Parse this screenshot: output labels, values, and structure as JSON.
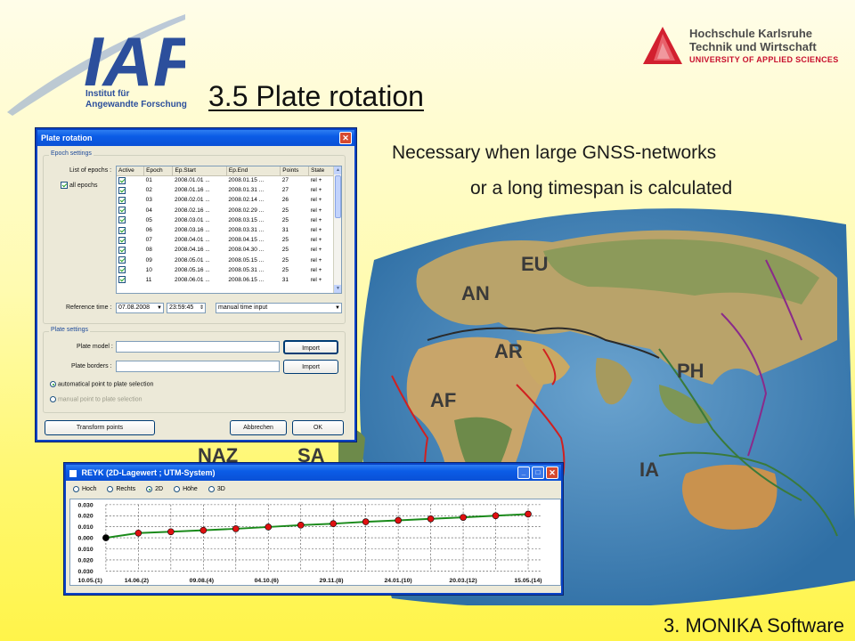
{
  "slide": {
    "title": "3.5 Plate rotation",
    "bullet_line_1": "Necessary when large GNSS-networks",
    "bullet_line_2": "or a long timespan is calculated",
    "footer": "3. MONIKA Software"
  },
  "logos": {
    "iaf_text": "IAF",
    "iaf_caption_1": "Institut für",
    "iaf_caption_2": "Angewandte Forschung",
    "hs_line_1": "Hochschule Karlsruhe",
    "hs_line_2": "Technik und Wirtschaft",
    "hs_line_3": "UNIVERSITY OF APPLIED SCIENCES"
  },
  "map": {
    "plate_labels": [
      "EU",
      "AN",
      "AR",
      "AF",
      "PH",
      "IA",
      "NAZ",
      "SA"
    ]
  },
  "plate_dialog": {
    "title": "Plate rotation",
    "epoch_group": "Epoch settings",
    "list_label": "List of epochs :",
    "all_epochs": "all epochs",
    "columns": [
      "Active",
      "Epoch",
      "Ep.Start",
      "Ep.End",
      "Points",
      "State"
    ],
    "rows": [
      [
        "01",
        "2008.01.01 ...",
        "2008.01.15 ...",
        "27",
        "rel +"
      ],
      [
        "02",
        "2008.01.16 ...",
        "2008.01.31 ...",
        "27",
        "rel +"
      ],
      [
        "03",
        "2008.02.01 ...",
        "2008.02.14 ...",
        "26",
        "rel +"
      ],
      [
        "04",
        "2008.02.16 ...",
        "2008.02.29 ...",
        "25",
        "rel +"
      ],
      [
        "05",
        "2008.03.01 ...",
        "2008.03.15 ...",
        "25",
        "rel +"
      ],
      [
        "06",
        "2008.03.16 ...",
        "2008.03.31 ...",
        "31",
        "rel +"
      ],
      [
        "07",
        "2008.04.01 ...",
        "2008.04.15 ...",
        "25",
        "rel +"
      ],
      [
        "08",
        "2008.04.16 ...",
        "2008.04.30 ...",
        "25",
        "rel +"
      ],
      [
        "09",
        "2008.05.01 ...",
        "2008.05.15 ...",
        "25",
        "rel +"
      ],
      [
        "10",
        "2008.05.16 ...",
        "2008.05.31 ...",
        "25",
        "rel +"
      ],
      [
        "11",
        "2008.06.01 ...",
        "2008.06.15 ...",
        "31",
        "rel +"
      ]
    ],
    "reference_label": "Reference time :",
    "reference_date": "07.08.2008",
    "reference_time": "23:59:45",
    "time_mode": "manual time input",
    "plate_group": "Plate settings",
    "plate_model_label": "Plate model :",
    "plate_borders_label": "Plate borders :",
    "import_label": "Import",
    "auto_point": "automatical point to plate selection",
    "manual_point": "manual point to plate selection",
    "transform_label": "Transform points",
    "cancel_label": "Abbrechen",
    "ok_label": "OK"
  },
  "reyk_window": {
    "title": "REYK (2D-Lagewert ; UTM-System)",
    "radio_options": [
      "Hoch",
      "Rechts",
      "2D",
      "Höhe",
      "3D"
    ],
    "selected": "2D",
    "y_ticks": [
      "0.030",
      "0.020",
      "0.010",
      "0.000",
      "0.010",
      "0.020",
      "0.030"
    ],
    "x_ticks": [
      "10.05.(1)",
      "14.06.(2)",
      "09.08.(4)",
      "04.10.(6)",
      "29.11.(8)",
      "24.01.(10)",
      "20.03.(12)",
      "15.05.(14)"
    ]
  },
  "chart_data": {
    "type": "line",
    "x": [
      1,
      2,
      3,
      4,
      5,
      6,
      7,
      8,
      9,
      10,
      11,
      12,
      13,
      14
    ],
    "values": [
      0.0,
      0.0043,
      0.0055,
      0.0068,
      0.0082,
      0.0098,
      0.0115,
      0.0128,
      0.0145,
      0.0158,
      0.0172,
      0.0185,
      0.02,
      0.0215
    ],
    "xticks": [
      "10.05.(1)",
      "14.06.(2)",
      "09.08.(4)",
      "04.10.(6)",
      "29.11.(8)",
      "24.01.(10)",
      "20.03.(12)",
      "15.05.(14)"
    ],
    "yticks": [
      "0.030",
      "0.020",
      "0.010",
      "0.000",
      "0.010",
      "0.020",
      "0.030"
    ],
    "ylim": [
      -0.03,
      0.03
    ],
    "grid": true,
    "colors": {
      "line": "#1a8a1a",
      "marker": "#e01010",
      "first_marker": "#000000"
    }
  }
}
